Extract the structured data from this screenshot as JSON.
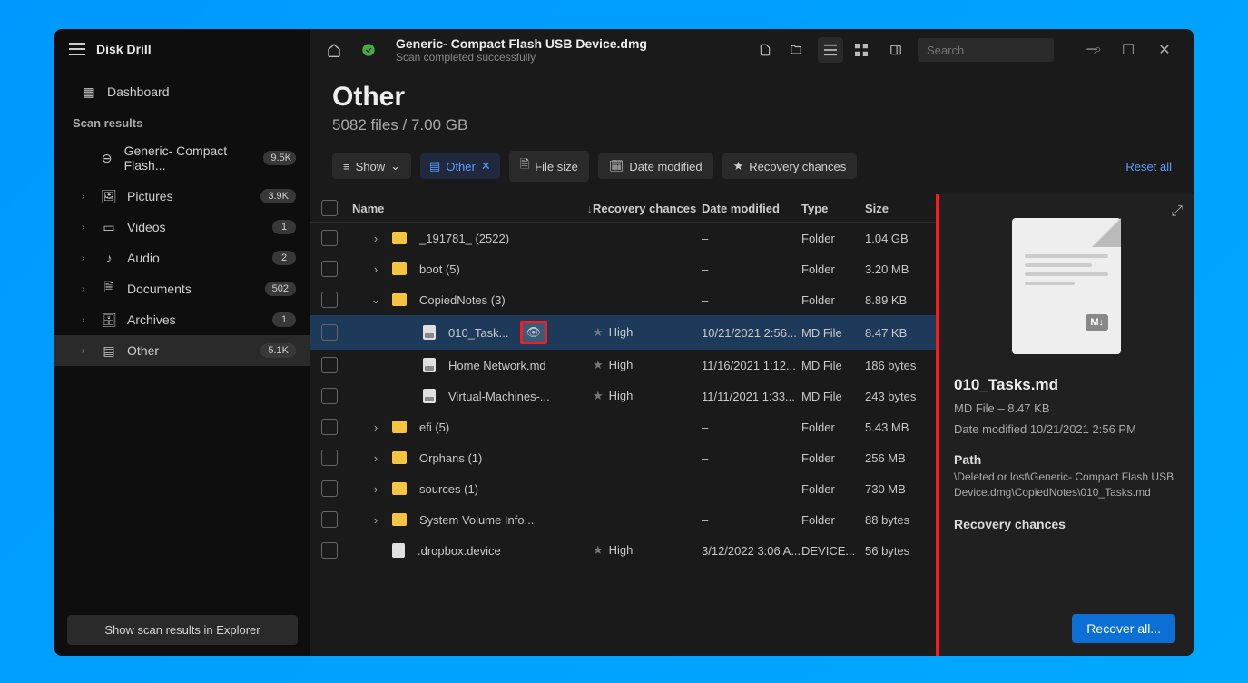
{
  "app": {
    "title": "Disk Drill"
  },
  "sidebar": {
    "dashboard": "Dashboard",
    "section": "Scan results",
    "items": [
      {
        "label": "Generic- Compact Flash...",
        "badge": "9.5K",
        "icon": "disk"
      },
      {
        "label": "Pictures",
        "badge": "3.9K",
        "icon": "image",
        "expandable": true
      },
      {
        "label": "Videos",
        "badge": "1",
        "icon": "video",
        "expandable": true
      },
      {
        "label": "Audio",
        "badge": "2",
        "icon": "audio",
        "expandable": true
      },
      {
        "label": "Documents",
        "badge": "502",
        "icon": "doc",
        "expandable": true
      },
      {
        "label": "Archives",
        "badge": "1",
        "icon": "archive",
        "expandable": true
      },
      {
        "label": "Other",
        "badge": "5.1K",
        "icon": "other",
        "expandable": true,
        "selected": true
      }
    ],
    "footer_btn": "Show scan results in Explorer"
  },
  "titlebar": {
    "title": "Generic- Compact Flash USB Device.dmg",
    "subtitle": "Scan completed successfully",
    "search_placeholder": "Search"
  },
  "header": {
    "title": "Other",
    "subtitle": "5082 files / 7.00 GB"
  },
  "filters": {
    "show": "Show",
    "active_chip": "Other",
    "file_size": "File size",
    "date_modified": "Date modified",
    "recovery": "Recovery chances",
    "reset": "Reset all"
  },
  "columns": {
    "name": "Name",
    "recovery": "Recovery chances",
    "date": "Date modified",
    "type": "Type",
    "size": "Size"
  },
  "rows": [
    {
      "name": "_191781_ (2522)",
      "rec": "",
      "date": "–",
      "type": "Folder",
      "size": "1.04 GB",
      "kind": "folder",
      "indent": 1,
      "expand": "›"
    },
    {
      "name": "boot (5)",
      "rec": "",
      "date": "–",
      "type": "Folder",
      "size": "3.20 MB",
      "kind": "folder",
      "indent": 1,
      "expand": "›"
    },
    {
      "name": "CopiedNotes (3)",
      "rec": "",
      "date": "–",
      "type": "Folder",
      "size": "8.89 KB",
      "kind": "folder",
      "indent": 1,
      "expand": "⌄"
    },
    {
      "name": "010_Task...",
      "rec": "High",
      "date": "10/21/2021 2:56...",
      "type": "MD File",
      "size": "8.47 KB",
      "kind": "md",
      "indent": 2,
      "selected": true,
      "eye": true
    },
    {
      "name": "Home Network.md",
      "rec": "High",
      "date": "11/16/2021 1:12...",
      "type": "MD File",
      "size": "186 bytes",
      "kind": "md",
      "indent": 2
    },
    {
      "name": "Virtual-Machines-...",
      "rec": "High",
      "date": "11/11/2021 1:33...",
      "type": "MD File",
      "size": "243 bytes",
      "kind": "md",
      "indent": 2
    },
    {
      "name": "efi (5)",
      "rec": "",
      "date": "–",
      "type": "Folder",
      "size": "5.43 MB",
      "kind": "folder",
      "indent": 1,
      "expand": "›"
    },
    {
      "name": "Orphans (1)",
      "rec": "",
      "date": "–",
      "type": "Folder",
      "size": "256 MB",
      "kind": "folder",
      "indent": 1,
      "expand": "›"
    },
    {
      "name": "sources (1)",
      "rec": "",
      "date": "–",
      "type": "Folder",
      "size": "730 MB",
      "kind": "folder",
      "indent": 1,
      "expand": "›"
    },
    {
      "name": "System Volume Info...",
      "rec": "",
      "date": "–",
      "type": "Folder",
      "size": "88 bytes",
      "kind": "folder",
      "indent": 1,
      "expand": "›"
    },
    {
      "name": ".dropbox.device",
      "rec": "High",
      "date": "3/12/2022 3:06 A...",
      "type": "DEVICE...",
      "size": "56 bytes",
      "kind": "file",
      "indent": 1
    }
  ],
  "details": {
    "filename": "010_Tasks.md",
    "meta": "MD File – 8.47 KB",
    "modified": "Date modified 10/21/2021 2:56 PM",
    "path_label": "Path",
    "path": "\\Deleted or lost\\Generic- Compact Flash USB Device.dmg\\CopiedNotes\\010_Tasks.md",
    "recovery_label": "Recovery chances",
    "badge": "M↓"
  },
  "footer": {
    "recover": "Recover all..."
  }
}
